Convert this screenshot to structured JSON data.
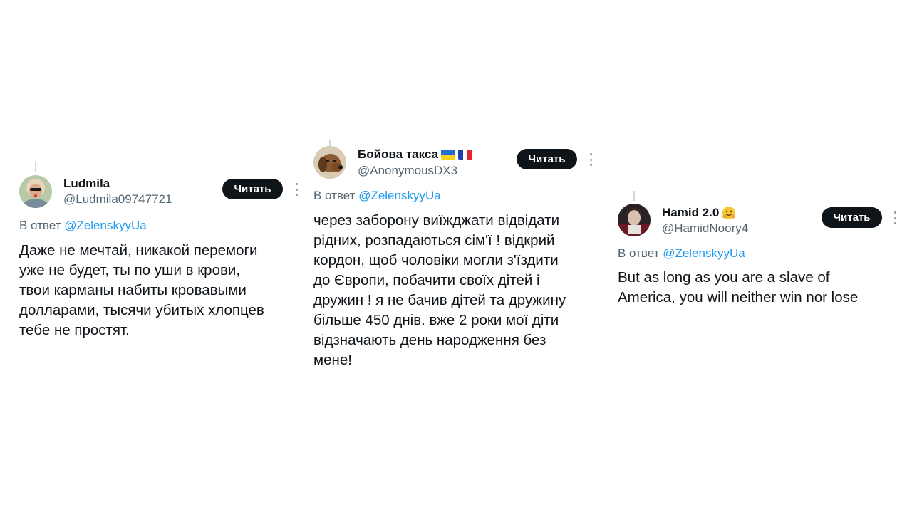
{
  "tweets": [
    {
      "display_name": "Ludmila",
      "handle": "@Ludmila09747721",
      "follow_label": "Читать",
      "reply_prefix": "В ответ",
      "reply_to": "@ZelenskyyUa",
      "avatar_icon": "woman-portrait-avatar",
      "body_lines": [
        "Даже не мечтай, никакой перемоги",
        "уже не будет, ты по уши в крови,",
        "твои карманы набиты кровавыми",
        "долларами, тысячи убитых хлопцев",
        "тебе не простят."
      ]
    },
    {
      "display_name": "Бойова такса",
      "handle": "@AnonymousDX3",
      "flags": [
        "ukraine-flag",
        "france-flag"
      ],
      "follow_label": "Читать",
      "reply_prefix": "В ответ",
      "reply_to": "@ZelenskyyUa",
      "avatar_icon": "dachshund-dog-avatar",
      "body_lines": [
        "через заборону виїжджати відвідати",
        "рідних, розпадаються сім'ї ! відкрий",
        "кордон, щоб чоловіки могли з'їздити",
        "до Європи, побачити своїх дітей і",
        "дружин ! я не бачив дітей та дружину",
        "більше 450 днів. вже 2 роки мої діти",
        "відзначають день народження без",
        "мене!"
      ]
    },
    {
      "display_name": "Hamid 2.0",
      "handle": "@HamidNoory4",
      "emoji": "hugging-face-emoji",
      "follow_label": "Читать",
      "reply_prefix": "В ответ",
      "reply_to": "@ZelenskyyUa",
      "avatar_icon": "person-portrait-avatar",
      "body_lines": [
        "But as long as you are a slave of",
        "America, you will neither win nor lose"
      ]
    }
  ],
  "colors": {
    "text": "#0f1419",
    "secondary": "#536471",
    "mention": "#1d9bf0",
    "button_bg": "#0f1419",
    "button_text": "#ffffff"
  }
}
